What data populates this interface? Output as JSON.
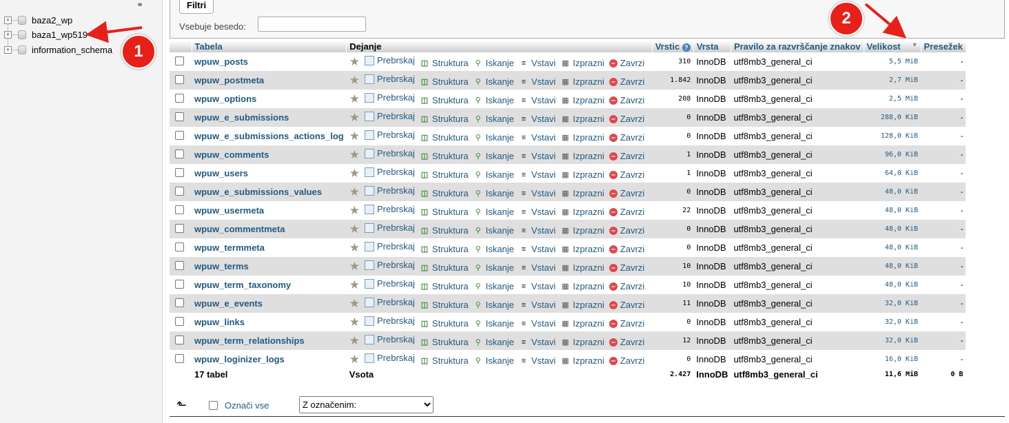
{
  "nav": {
    "databases": [
      {
        "name": "baza2_wp"
      },
      {
        "name": "baza1_wp519"
      },
      {
        "name": "information_schema"
      }
    ]
  },
  "filters": {
    "legend": "Filtri",
    "contains_label": "Vsebuje besedo:",
    "contains_value": ""
  },
  "table": {
    "headers": {
      "tabela": "Tabela",
      "dejanje": "Dejanje",
      "vrstic": "Vrstic",
      "vrsta": "Vrsta",
      "pravilo": "Pravilo za razvrščanje znakov",
      "velikost": "Velikost",
      "presezek": "Presežek"
    },
    "actions": {
      "browse": "Prebrskaj",
      "structure": "Struktura",
      "search": "Iskanje",
      "insert": "Vstavi",
      "empty": "Izprazni",
      "drop": "Zavrzi"
    },
    "rows": [
      {
        "name": "wpuw_posts",
        "rows": "310",
        "type": "InnoDB",
        "collation": "utf8mb3_general_ci",
        "size": "5,5 MiB",
        "overhead": "-"
      },
      {
        "name": "wpuw_postmeta",
        "rows": "1.842",
        "type": "InnoDB",
        "collation": "utf8mb3_general_ci",
        "size": "2,7 MiB",
        "overhead": "-"
      },
      {
        "name": "wpuw_options",
        "rows": "208",
        "type": "InnoDB",
        "collation": "utf8mb3_general_ci",
        "size": "2,5 MiB",
        "overhead": "-"
      },
      {
        "name": "wpuw_e_submissions",
        "rows": "0",
        "type": "InnoDB",
        "collation": "utf8mb3_general_ci",
        "size": "288,0 KiB",
        "overhead": "-"
      },
      {
        "name": "wpuw_e_submissions_actions_log",
        "rows": "0",
        "type": "InnoDB",
        "collation": "utf8mb3_general_ci",
        "size": "128,0 KiB",
        "overhead": "-"
      },
      {
        "name": "wpuw_comments",
        "rows": "1",
        "type": "InnoDB",
        "collation": "utf8mb3_general_ci",
        "size": "96,0 KiB",
        "overhead": "-"
      },
      {
        "name": "wpuw_users",
        "rows": "1",
        "type": "InnoDB",
        "collation": "utf8mb3_general_ci",
        "size": "64,0 KiB",
        "overhead": "-"
      },
      {
        "name": "wpuw_e_submissions_values",
        "rows": "0",
        "type": "InnoDB",
        "collation": "utf8mb3_general_ci",
        "size": "48,0 KiB",
        "overhead": "-"
      },
      {
        "name": "wpuw_usermeta",
        "rows": "22",
        "type": "InnoDB",
        "collation": "utf8mb3_general_ci",
        "size": "48,0 KiB",
        "overhead": "-"
      },
      {
        "name": "wpuw_commentmeta",
        "rows": "0",
        "type": "InnoDB",
        "collation": "utf8mb3_general_ci",
        "size": "48,0 KiB",
        "overhead": "-"
      },
      {
        "name": "wpuw_termmeta",
        "rows": "0",
        "type": "InnoDB",
        "collation": "utf8mb3_general_ci",
        "size": "48,0 KiB",
        "overhead": "-"
      },
      {
        "name": "wpuw_terms",
        "rows": "10",
        "type": "InnoDB",
        "collation": "utf8mb3_general_ci",
        "size": "48,0 KiB",
        "overhead": "-"
      },
      {
        "name": "wpuw_term_taxonomy",
        "rows": "10",
        "type": "InnoDB",
        "collation": "utf8mb3_general_ci",
        "size": "48,0 KiB",
        "overhead": "-"
      },
      {
        "name": "wpuw_e_events",
        "rows": "11",
        "type": "InnoDB",
        "collation": "utf8mb3_general_ci",
        "size": "32,0 KiB",
        "overhead": "-"
      },
      {
        "name": "wpuw_links",
        "rows": "0",
        "type": "InnoDB",
        "collation": "utf8mb3_general_ci",
        "size": "32,0 KiB",
        "overhead": "-"
      },
      {
        "name": "wpuw_term_relationships",
        "rows": "12",
        "type": "InnoDB",
        "collation": "utf8mb3_general_ci",
        "size": "32,0 KiB",
        "overhead": "-"
      },
      {
        "name": "wpuw_loginizer_logs",
        "rows": "0",
        "type": "InnoDB",
        "collation": "utf8mb3_general_ci",
        "size": "16,0 KiB",
        "overhead": "-"
      }
    ],
    "footer": {
      "count": "17 tabel",
      "label": "Vsota",
      "rows": "2.427",
      "type": "InnoDB",
      "collation": "utf8mb3_general_ci",
      "size": "11,6 MiB",
      "overhead": "0 B"
    }
  },
  "bottom": {
    "select_all": "Označi vse",
    "with_selected": "Z označenim:"
  },
  "annotations": {
    "badge1": "1",
    "badge2": "2",
    "color": "#e8201a"
  }
}
